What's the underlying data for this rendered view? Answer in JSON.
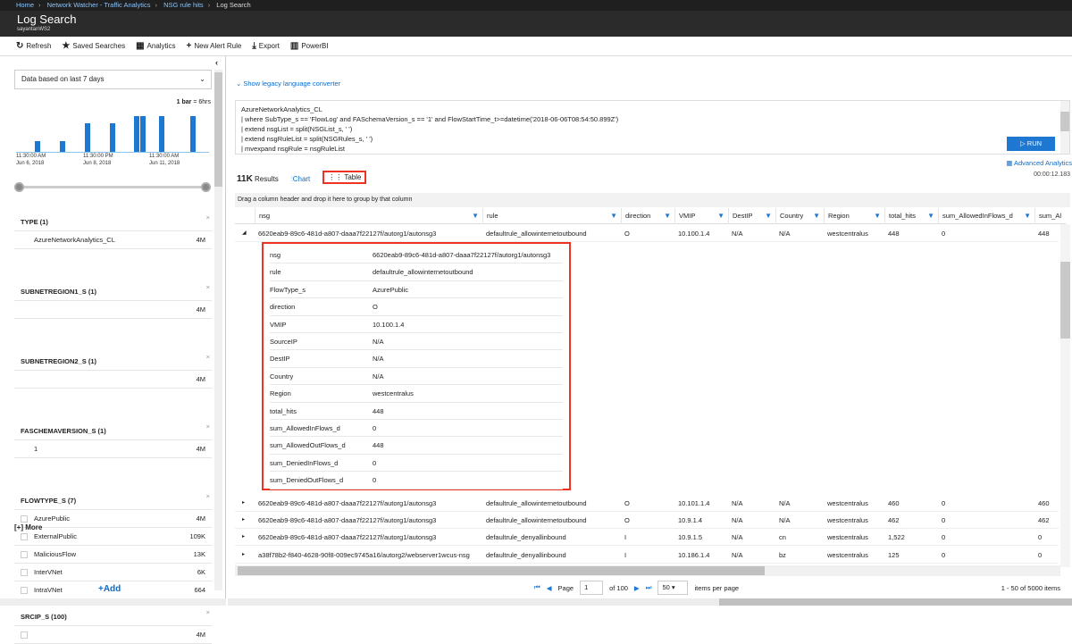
{
  "breadcrumb": [
    "Home",
    "Network Watcher - Traffic Analytics",
    "NSG rule hits",
    "Log Search"
  ],
  "header": {
    "title": "Log Search",
    "subtitle": "sayantanWS2"
  },
  "toolbar": [
    {
      "icon": "refresh-icon",
      "glyph": "↻",
      "label": "Refresh"
    },
    {
      "icon": "star-icon",
      "glyph": "★",
      "label": "Saved Searches"
    },
    {
      "icon": "analytics-icon",
      "glyph": "▦",
      "label": "Analytics"
    },
    {
      "icon": "plus-icon",
      "glyph": "+",
      "label": "New Alert Rule"
    },
    {
      "icon": "download-icon",
      "glyph": "⤓",
      "label": "Export"
    },
    {
      "icon": "powerbi-icon",
      "glyph": "▥",
      "label": "PowerBI"
    }
  ],
  "sidebar": {
    "time_range": "Data based on last 7 days",
    "bar_legend_bold": "1 bar",
    "bar_legend_rest": " = 6hrs",
    "histogram": [
      0,
      0,
      0,
      0.3,
      0,
      0,
      0,
      0.3,
      0,
      0,
      0,
      0.8,
      0,
      0,
      0,
      0.8,
      0,
      0,
      0,
      1,
      1,
      0,
      0,
      1,
      0,
      0,
      0,
      0,
      1,
      0,
      0
    ],
    "x_labels": [
      {
        "time": "11:30:00 AM",
        "date": "Jun 6, 2018"
      },
      {
        "time": "11:30:00 PM",
        "date": "Jun 8, 2018"
      },
      {
        "time": "11:30:00 AM",
        "date": "Jun 11, 2018"
      }
    ],
    "facets": [
      {
        "title": "TYPE  (1)",
        "rows": [
          {
            "label": "AzureNetworkAnalytics_CL",
            "count": "4M"
          }
        ]
      },
      {
        "title": "SUBNETREGION1_S  (1)",
        "rows": [
          {
            "label": "",
            "count": "4M"
          }
        ]
      },
      {
        "title": "SUBNETREGION2_S  (1)",
        "rows": [
          {
            "label": "",
            "count": "4M"
          }
        ]
      },
      {
        "title": "FASCHEMAVERSION_S  (1)",
        "rows": [
          {
            "label": "1",
            "count": "4M"
          }
        ]
      },
      {
        "title": "FLOWTYPE_S  (7)",
        "checkbox": true,
        "rows": [
          {
            "label": "AzurePublic",
            "count": "4M"
          },
          {
            "label": "ExternalPublic",
            "count": "109K"
          },
          {
            "label": "MaliciousFlow",
            "count": "13K"
          },
          {
            "label": "InterVNet",
            "count": "6K"
          },
          {
            "label": "IntraVNet",
            "count": "664"
          }
        ]
      },
      {
        "title": "SRCIP_S  (100)",
        "checkbox": true,
        "rows": [
          {
            "label": "",
            "count": "4M"
          }
        ]
      }
    ],
    "more": "[+] More",
    "add": "+Add"
  },
  "main": {
    "legacy": "Show legacy language converter",
    "query": [
      "AzureNetworkAnalytics_CL",
      "| where SubType_s == 'FlowLog'  and FASchemaVersion_s == '1' and FlowStartTime_t>=datetime('2018-06-06T08:54:50.899Z')",
      "| extend nsgList = split(NSGList_s, ' ')",
      "| extend nsgRuleList = split(NSGRules_s, ' ')",
      "| mvexpand nsgRule = nsgRuleList"
    ],
    "run": "RUN",
    "advanced": "Advanced Analytics",
    "elapsed": "00:00:12.183",
    "results_count": "11K",
    "results_label": "Results",
    "tab_chart": "Chart",
    "tab_table": "Table",
    "active_tab": "Table",
    "group_hint": "Drag a column header and drop it here to group by that column",
    "columns": [
      "nsg",
      "rule",
      "direction",
      "VMIP",
      "DestIP",
      "Country",
      "Region",
      "total_hits",
      "sum_AllowedInFlows_d",
      "sum_Al"
    ],
    "rows": [
      [
        "6620eab9-89c6-481d-a807-daaa7f22127f/autorg1/autonsg3",
        "defaultrule_allowinternetoutbound",
        "O",
        "10.100.1.4",
        "N/A",
        "N/A",
        "westcentralus",
        "448",
        "0",
        "448"
      ],
      [
        "6620eab9-89c6-481d-a807-daaa7f22127f/autorg1/autonsg3",
        "defaultrule_allowinternetoutbound",
        "O",
        "10.101.1.4",
        "N/A",
        "N/A",
        "westcentralus",
        "460",
        "0",
        "460"
      ],
      [
        "6620eab9-89c6-481d-a807-daaa7f22127f/autorg1/autonsg3",
        "defaultrule_allowinternetoutbound",
        "O",
        "10.9.1.4",
        "N/A",
        "N/A",
        "westcentralus",
        "462",
        "0",
        "462"
      ],
      [
        "6620eab9-89c6-481d-a807-daaa7f22127f/autorg1/autonsg3",
        "defaultrule_denyallinbound",
        "I",
        "10.9.1.5",
        "N/A",
        "cn",
        "westcentralus",
        "1,522",
        "0",
        "0"
      ],
      [
        "a38f78b2-f840-4628-90f8-009ec9745a16/autorg2/webserver1wcus-nsg",
        "defaultrule_denyallinbound",
        "I",
        "10.186.1.4",
        "N/A",
        "bz",
        "westcentralus",
        "125",
        "0",
        "0"
      ]
    ],
    "detail": [
      [
        "nsg",
        "6620eab9-89c6-481d-a807-daaa7f22127f/autorg1/autonsg3"
      ],
      [
        "rule",
        "defaultrule_allowinternetoutbound"
      ],
      [
        "FlowType_s",
        "AzurePublic"
      ],
      [
        "direction",
        "O"
      ],
      [
        "VMIP",
        "10.100.1.4"
      ],
      [
        "SourceIP",
        "N/A"
      ],
      [
        "DestIP",
        "N/A"
      ],
      [
        "Country",
        "N/A"
      ],
      [
        "Region",
        "westcentralus"
      ],
      [
        "total_hits",
        "448"
      ],
      [
        "sum_AllowedInFlows_d",
        "0"
      ],
      [
        "sum_AllowedOutFlows_d",
        "448"
      ],
      [
        "sum_DeniedInFlows_d",
        "0"
      ],
      [
        "sum_DeniedOutFlows_d",
        "0"
      ]
    ],
    "pager": {
      "page_label": "Page",
      "page": "1",
      "of": "of 100",
      "page_size": "50",
      "per_page": "items per page",
      "count": "1 - 50 of 5000 items"
    }
  }
}
